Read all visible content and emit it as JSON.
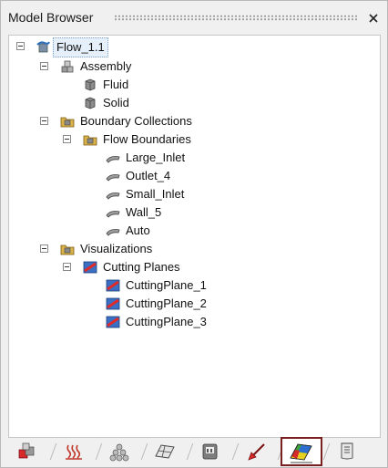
{
  "panel": {
    "title": "Model Browser"
  },
  "tree": [
    {
      "label": "Flow_1.1",
      "icon": "flow-icon"
    },
    {
      "label": "Assembly",
      "icon": "assembly-icon"
    },
    {
      "label": "Fluid",
      "icon": "part-icon"
    },
    {
      "label": "Solid",
      "icon": "part-icon"
    },
    {
      "label": "Boundary Collections",
      "icon": "folder-collection-icon"
    },
    {
      "label": "Flow Boundaries",
      "icon": "folder-collection-icon"
    },
    {
      "label": "Large_Inlet",
      "icon": "surface-icon"
    },
    {
      "label": "Outlet_4",
      "icon": "surface-icon"
    },
    {
      "label": "Small_Inlet",
      "icon": "surface-icon"
    },
    {
      "label": "Wall_5",
      "icon": "surface-icon"
    },
    {
      "label": "Auto",
      "icon": "surface-icon"
    },
    {
      "label": "Visualizations",
      "icon": "folder-collection-icon"
    },
    {
      "label": "Cutting Planes",
      "icon": "cutting-plane-icon"
    },
    {
      "label": "CuttingPlane_1",
      "icon": "cutting-plane-icon"
    },
    {
      "label": "CuttingPlane_2",
      "icon": "cutting-plane-icon"
    },
    {
      "label": "CuttingPlane_3",
      "icon": "cutting-plane-icon"
    }
  ],
  "tabs": [
    {
      "icon": "model-parts-icon"
    },
    {
      "icon": "physics-icon"
    },
    {
      "icon": "particles-icon"
    },
    {
      "icon": "mesh-icon"
    },
    {
      "icon": "analysis-ai-icon"
    },
    {
      "icon": "arrow-pen-icon"
    },
    {
      "icon": "contour-plot-icon",
      "active": true
    },
    {
      "icon": "report-icon"
    }
  ],
  "colors": {
    "active_tab_outline": "#7a1f1f",
    "selection": "#e6f0fa"
  }
}
